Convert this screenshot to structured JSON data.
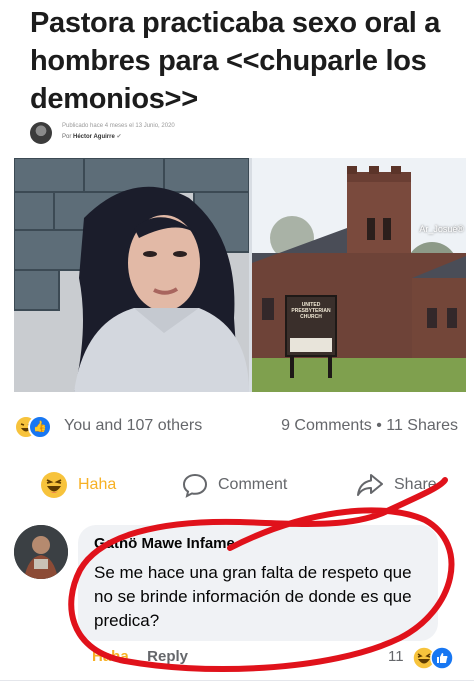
{
  "headline": "Pastora practicaba sexo oral a hombres para <<chuparle los demonios>>",
  "byline": {
    "meta_line": "Publicado hace 4 meses el 13 Junio, 2020",
    "author_prefix": "Por",
    "author": "Héctor Aguirre"
  },
  "photo": {
    "church_sign": "UNITED PRESBYTERIAN CHURCH",
    "watermark": "Ar_Josué®"
  },
  "reactions": {
    "summary": "You and 107 others",
    "stats": "9 Comments • 11 Shares"
  },
  "actions": {
    "haha": "Haha",
    "comment": "Comment",
    "share": "Share"
  },
  "comment": {
    "author": "Gathö Mawe Infame",
    "text": "Se me hace una gran falta de respeto que no se brinde información de donde es que predica?",
    "haha_link": "Haha",
    "reply_link": "Reply",
    "reaction_count": "11"
  },
  "colors": {
    "haha": "#f7b125",
    "like": "#1877f2",
    "annotation": "#e0121b",
    "secondary_text": "#65676b"
  }
}
